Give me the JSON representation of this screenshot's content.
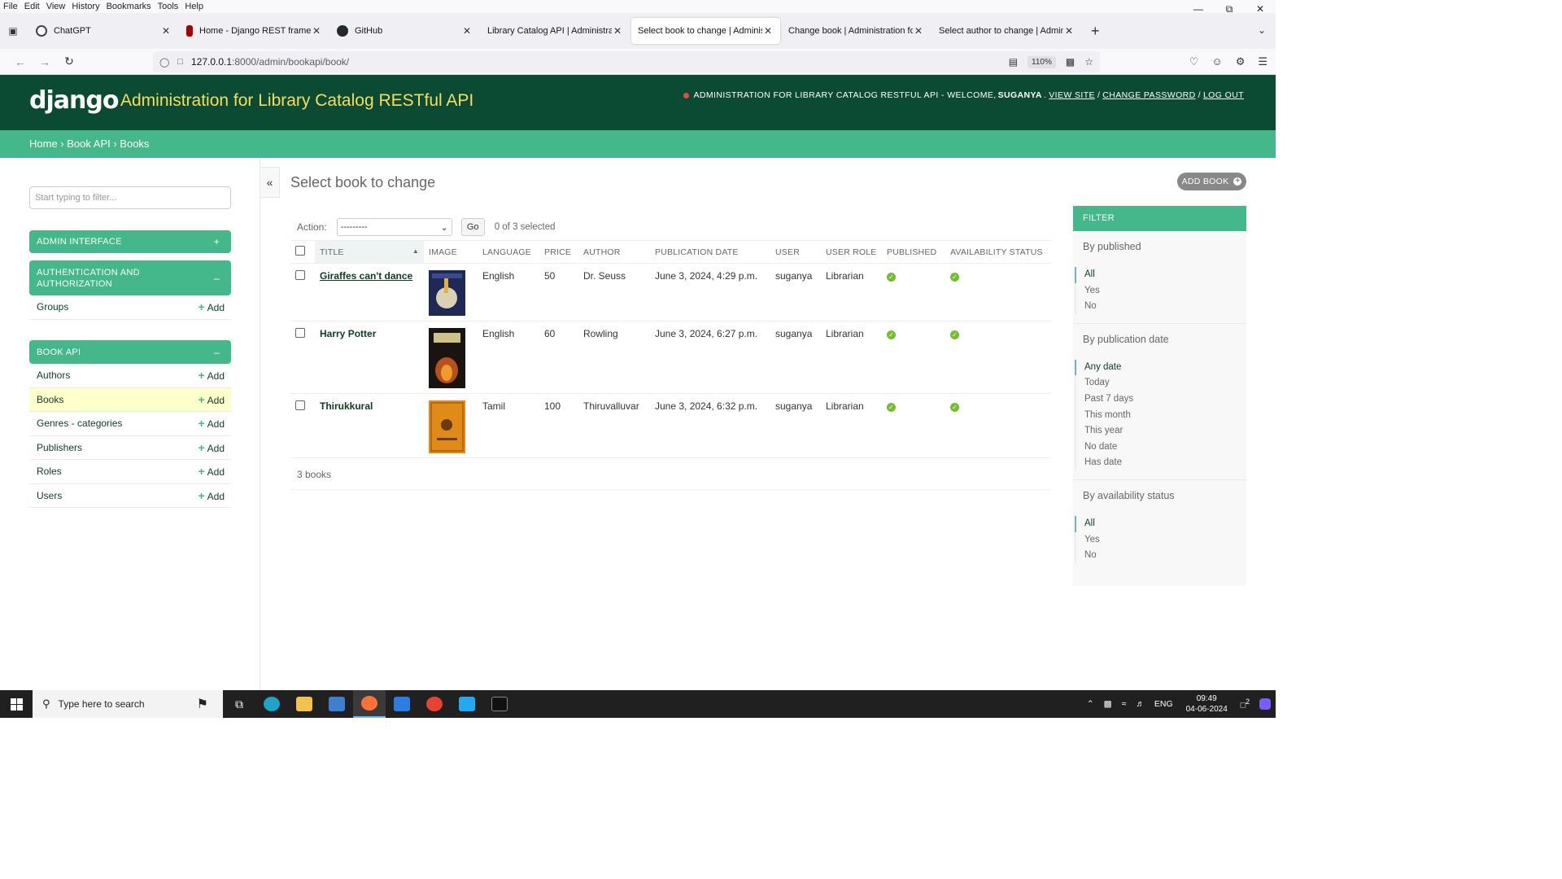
{
  "browser": {
    "menu": [
      "File",
      "Edit",
      "View",
      "History",
      "Bookmarks",
      "Tools",
      "Help"
    ],
    "tabs": [
      {
        "title": "ChatGPT",
        "color": "#444444"
      },
      {
        "title": "Home - Django REST framework",
        "color": "#a30000"
      },
      {
        "title": "GitHub",
        "color": "#24292f"
      },
      {
        "title": "Library Catalog API | Administration",
        "color": "#ffffff"
      },
      {
        "title": "Select book to change | Administration",
        "color": "#ffffff"
      },
      {
        "title": "Change book | Administration for Library",
        "color": "#ffffff"
      },
      {
        "title": "Select author to change | Administration",
        "color": "#ffffff"
      }
    ],
    "url_host": "127.0.0.1",
    "url_path": ":8000/admin/bookapi/book/",
    "zoom": "110%"
  },
  "header": {
    "logo": "django",
    "branding": "Administration for Library Catalog RESTful API",
    "tools_prefix": "ADMINISTRATION FOR LIBRARY CATALOG RESTFUL API - WELCOME,",
    "username": "SUGANYA",
    "view_site": "VIEW SITE",
    "change_password": "CHANGE PASSWORD",
    "log_out": "LOG OUT"
  },
  "breadcrumbs": {
    "home": "Home",
    "app": "Book API",
    "model": "Books"
  },
  "sidebar": {
    "filter_placeholder": "Start typing to filter...",
    "admin_interface": "ADMIN INTERFACE",
    "auth_title": "AUTHENTICATION AND AUTHORIZATION",
    "auth_items": [
      {
        "label": "Groups",
        "add": "Add"
      }
    ],
    "bookapi_title": "BOOK API",
    "bookapi_items": [
      {
        "label": "Authors",
        "add": "Add"
      },
      {
        "label": "Books",
        "add": "Add"
      },
      {
        "label": "Genres - categories",
        "add": "Add"
      },
      {
        "label": "Publishers",
        "add": "Add"
      },
      {
        "label": "Roles",
        "add": "Add"
      },
      {
        "label": "Users",
        "add": "Add"
      }
    ]
  },
  "main": {
    "title": "Select book to change",
    "add_button": "ADD BOOK",
    "action_label": "Action:",
    "action_value": "---------",
    "go": "Go",
    "selected": "0 of 3 selected",
    "columns": [
      "TITLE",
      "IMAGE",
      "LANGUAGE",
      "PRICE",
      "AUTHOR",
      "PUBLICATION DATE",
      "USER",
      "USER ROLE",
      "PUBLISHED",
      "AVAILABILITY STATUS"
    ],
    "rows": [
      {
        "title": "Giraffes can't dance",
        "language": "English",
        "price": "50",
        "author": "Dr. Seuss",
        "date": "June 3, 2024, 4:29 p.m.",
        "user": "suganya",
        "role": "Librarian",
        "published": true,
        "available": true
      },
      {
        "title": "Harry Potter",
        "language": "English",
        "price": "60",
        "author": "Rowling",
        "date": "June 3, 2024, 6:27 p.m.",
        "user": "suganya",
        "role": "Librarian",
        "published": true,
        "available": true
      },
      {
        "title": "Thirukkural",
        "language": "Tamil",
        "price": "100",
        "author": "Thiruvalluvar",
        "date": "June 3, 2024, 6:32 p.m.",
        "user": "suganya",
        "role": "Librarian",
        "published": true,
        "available": true
      }
    ],
    "count": "3 books"
  },
  "filter": {
    "caption": "FILTER",
    "published_title": "By published",
    "published_opts": [
      "All",
      "Yes",
      "No"
    ],
    "date_title": "By publication date",
    "date_opts": [
      "Any date",
      "Today",
      "Past 7 days",
      "This month",
      "This year",
      "No date",
      "Has date"
    ],
    "avail_title": "By availability status",
    "avail_opts": [
      "All",
      "Yes",
      "No"
    ]
  },
  "taskbar": {
    "search": "Type here to search",
    "lang": "ENG",
    "time": "09:49",
    "date": "04-06-2024",
    "notif": "2"
  },
  "colors": {
    "header": "#0c4b33",
    "accent": "#44b78b",
    "branding": "#f5dd5d"
  }
}
